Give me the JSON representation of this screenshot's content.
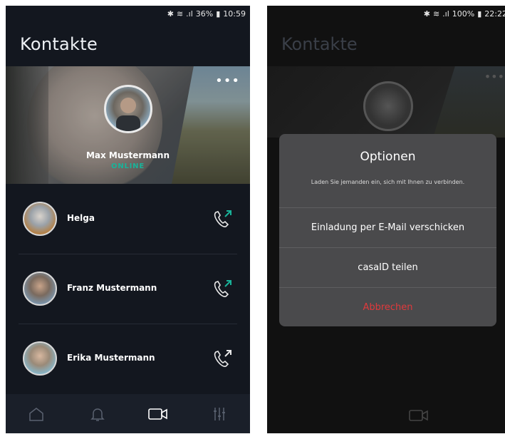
{
  "left_screen": {
    "status": {
      "signal": "36%",
      "time": "10:59"
    },
    "title": "Kontakte",
    "profile": {
      "name": "Max Mustermann",
      "status": "ONLINE",
      "more": "•••"
    },
    "contacts": [
      {
        "name": "Helga",
        "call_icon": "phone-outgoing-icon"
      },
      {
        "name": "Franz Mustermann",
        "call_icon": "phone-outgoing-icon"
      },
      {
        "name": "Erika Mustermann",
        "call_icon": "phone-outgoing-icon"
      }
    ],
    "nav": [
      {
        "icon": "home-icon",
        "active": false
      },
      {
        "icon": "bell-icon",
        "active": false
      },
      {
        "icon": "video-camera-icon",
        "active": true
      },
      {
        "icon": "sliders-icon",
        "active": false
      }
    ],
    "colors": {
      "online": "#19b39a",
      "call_accent": "#19b39a"
    }
  },
  "right_screen": {
    "status": {
      "signal": "100%",
      "time": "22:22"
    },
    "background_title": "Kontakte",
    "dialog": {
      "title": "Optionen",
      "message": "Laden Sie jemanden ein, sich mit Ihnen zu verbinden.",
      "option_email": "Einladung per E-Mail verschicken",
      "option_casaid": "casaID teilen",
      "cancel": "Abbrechen"
    },
    "colors": {
      "cancel": "#e0393c"
    }
  }
}
